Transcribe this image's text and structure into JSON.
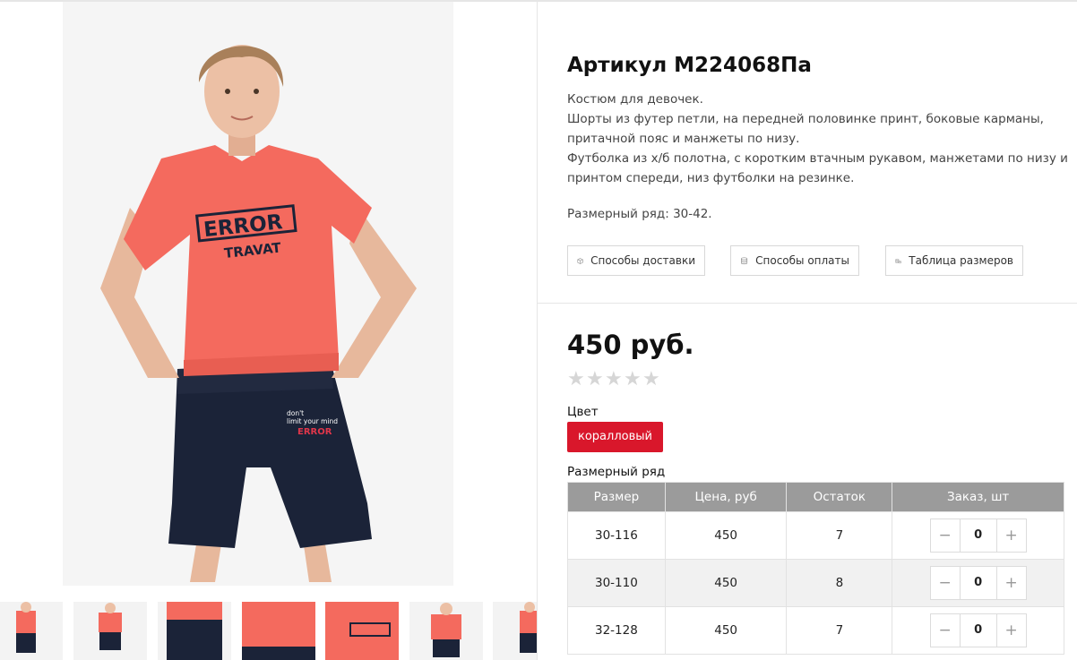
{
  "product": {
    "title": "Артикул М224068Па",
    "description": [
      "Костюм для девочек.",
      "Шорты из футер петли, на передней половинке принт, боковые карманы,",
      "притачной пояс и манжеты по низу.",
      "Футболка из х/б полотна, с коротким втачным рукавом, манжетами по низу и",
      "принтом спереди, низ футболки на резинке."
    ],
    "size_range": "Размерный ряд: 30-42.",
    "price": "450 руб.",
    "rating_stars": 0,
    "color_label": "Цвет",
    "color_value": "коралловый",
    "sizes_label": "Размерный ряд"
  },
  "print_text": {
    "error": "ERROR",
    "art": "TRAVAT",
    "shorts_line1": "don't",
    "shorts_line2": "limit your mind",
    "shorts_error": "ERROR"
  },
  "info_buttons": [
    {
      "label": "Способы доставки",
      "icon": "box-icon"
    },
    {
      "label": "Способы оплаты",
      "icon": "coins-icon"
    },
    {
      "label": "Таблица размеров",
      "icon": "coins-stack-icon"
    }
  ],
  "table": {
    "headers": [
      "Размер",
      "Цена, руб",
      "Остаток",
      "Заказ, шт"
    ],
    "rows": [
      {
        "size": "30-116",
        "price": "450",
        "stock": "7",
        "qty": "0"
      },
      {
        "size": "30-110",
        "price": "450",
        "stock": "8",
        "qty": "0"
      },
      {
        "size": "32-128",
        "price": "450",
        "stock": "7",
        "qty": "0"
      }
    ],
    "minus": "−",
    "plus": "+"
  },
  "colors": {
    "accent_red": "#d9172b",
    "table_header": "#9b9b9b",
    "coral_shirt": "#f46a5e",
    "navy_shorts": "#1b2338"
  }
}
